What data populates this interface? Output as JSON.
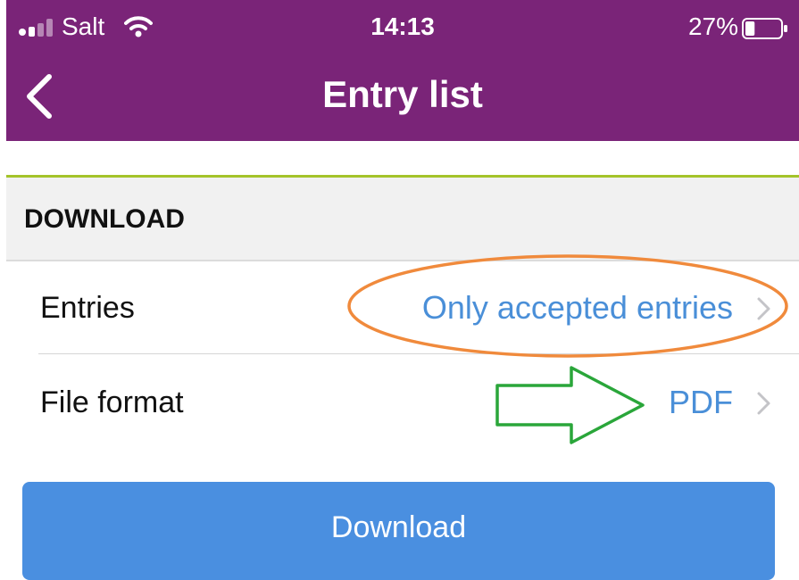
{
  "status_bar": {
    "carrier": "Salt",
    "time": "14:13",
    "battery_percent": "27%",
    "battery_level": 0.27
  },
  "nav": {
    "title": "Entry list",
    "back_icon": "chevron-left-icon"
  },
  "section": {
    "title": "DOWNLOAD"
  },
  "rows": [
    {
      "label": "Entries",
      "value": "Only accepted entries",
      "icon": "chevron-right-icon"
    },
    {
      "label": "File format",
      "value": "PDF",
      "icon": "chevron-right-icon"
    }
  ],
  "button": {
    "label": "Download"
  },
  "colors": {
    "header": "#7a2478",
    "accent_line": "#a4c32a",
    "link_blue": "#4a8fd8",
    "button": "#4a8fe0",
    "annotation_orange": "#f08a3c",
    "annotation_green": "#2aa63a"
  }
}
